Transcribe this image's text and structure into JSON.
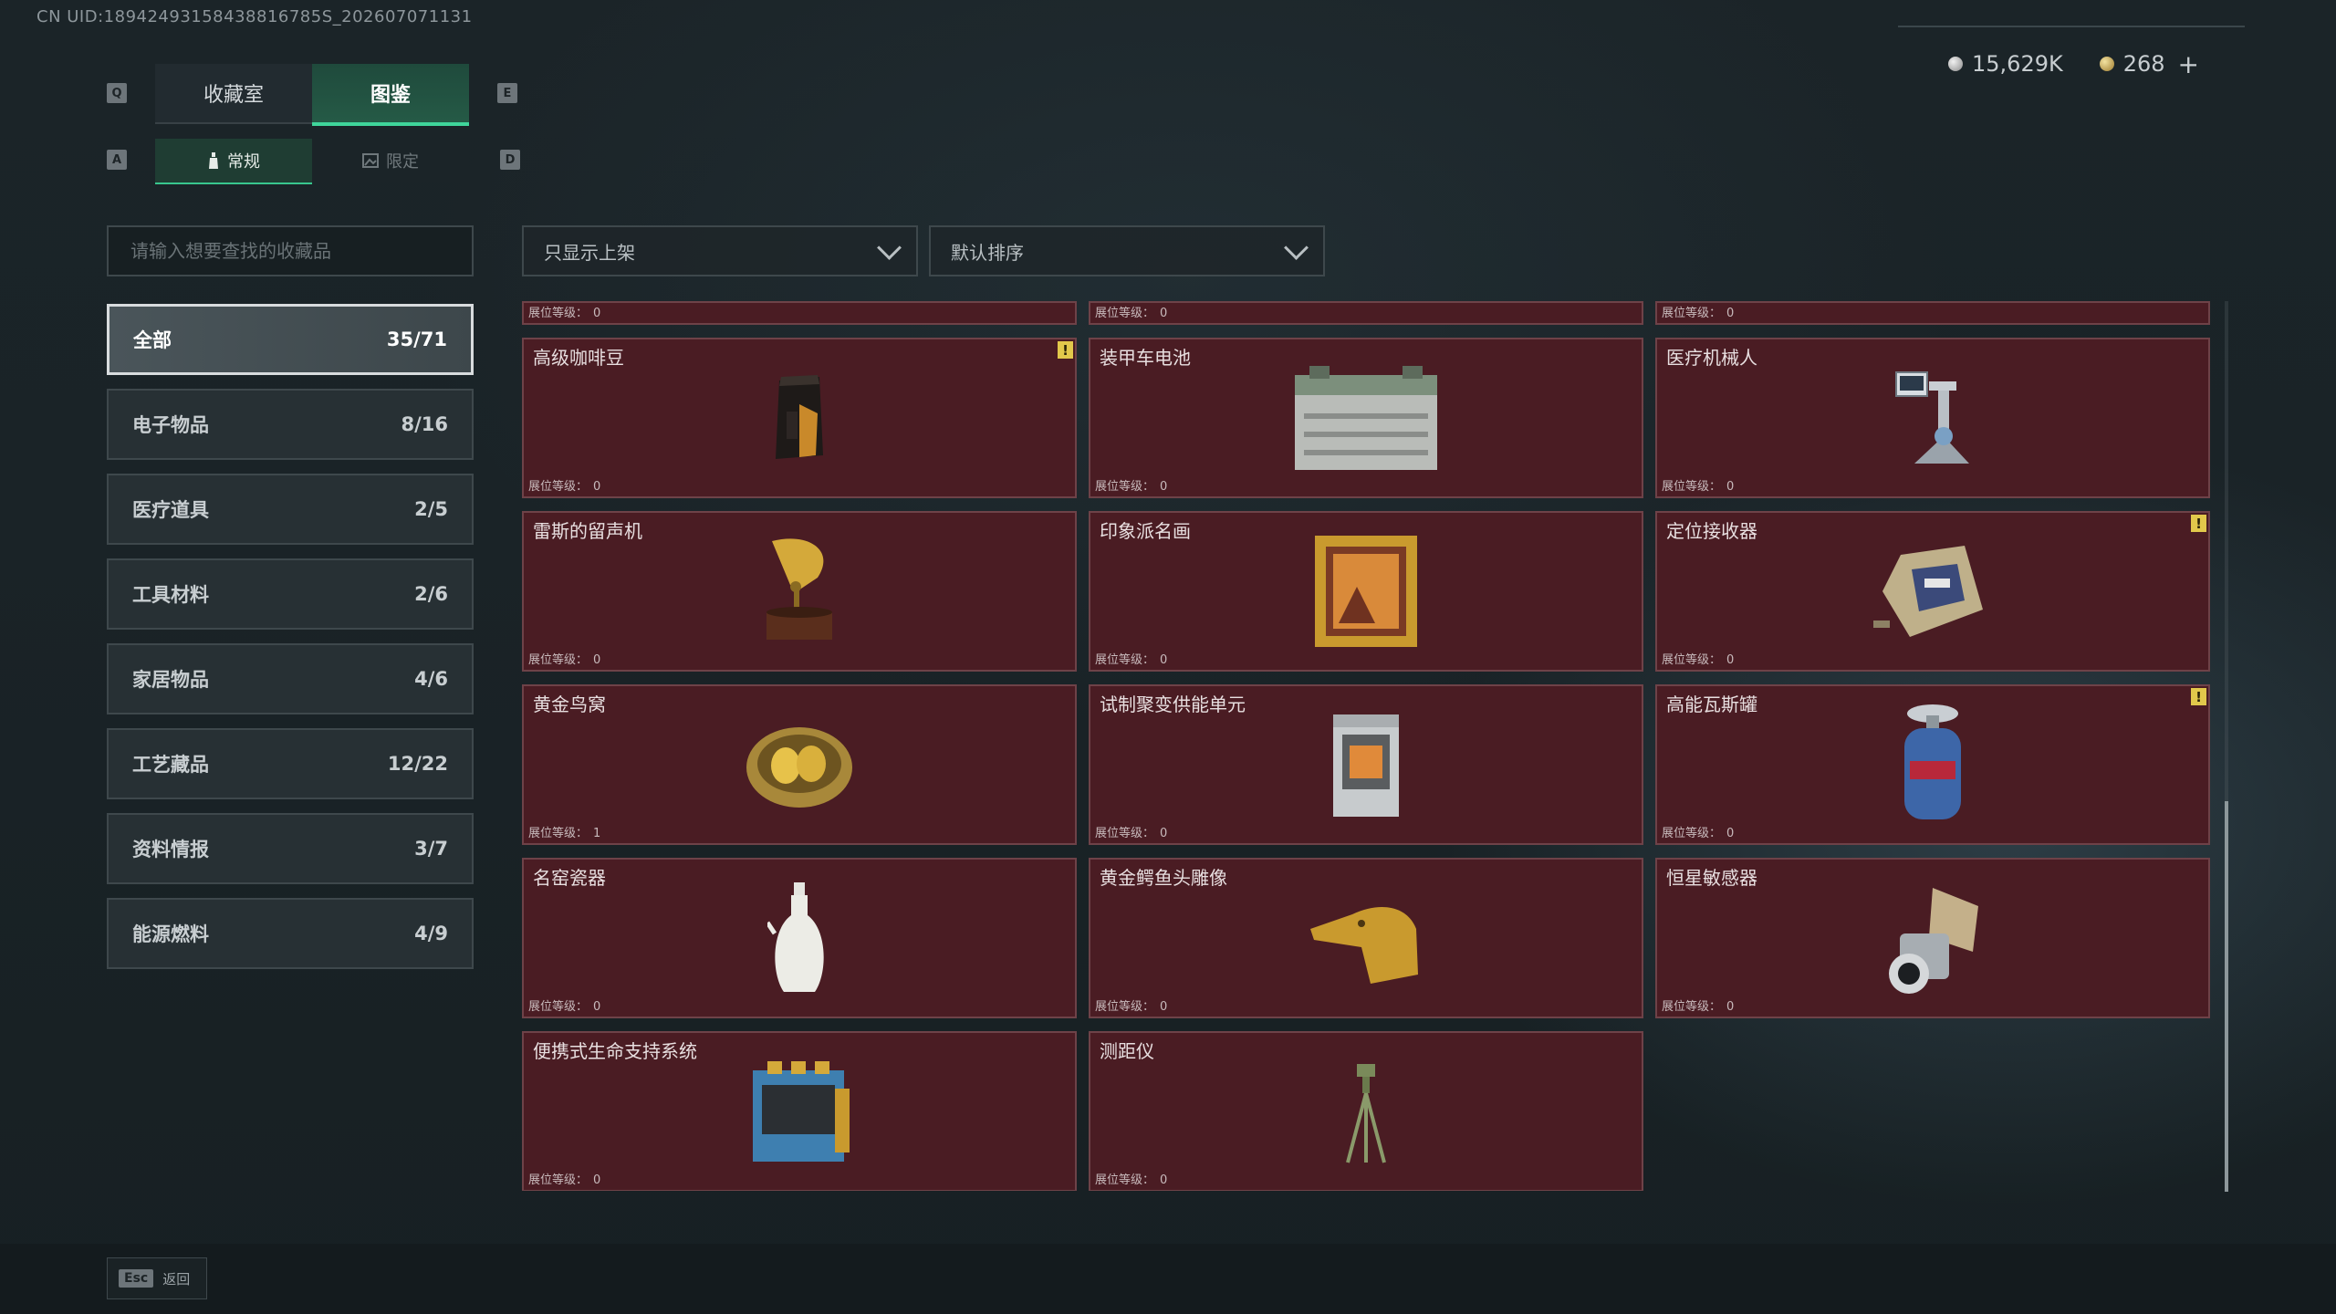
{
  "uid_text": "CN UID:18942493158438816785S_202607071131",
  "currency": {
    "silver": "15,629K",
    "gold": "268",
    "plus": "+"
  },
  "keys": {
    "prev_tab": "Q",
    "next_tab": "E",
    "prev_sub": "A",
    "next_sub": "D"
  },
  "main_tabs": [
    {
      "label": "收藏室",
      "active": false
    },
    {
      "label": "图鉴",
      "active": true
    }
  ],
  "sub_tabs": [
    {
      "label": "常规",
      "active": true
    },
    {
      "label": "限定",
      "active": false
    }
  ],
  "search": {
    "placeholder": "请输入想要查找的收藏品"
  },
  "filters": {
    "shelf_filter": "只显示上架",
    "sort": "默认排序"
  },
  "categories": [
    {
      "label": "全部",
      "count": "35/71",
      "active": true
    },
    {
      "label": "电子物品",
      "count": "8/16"
    },
    {
      "label": "医疗道具",
      "count": "2/5"
    },
    {
      "label": "工具材料",
      "count": "2/6"
    },
    {
      "label": "家居物品",
      "count": "4/6"
    },
    {
      "label": "工艺藏品",
      "count": "12/22"
    },
    {
      "label": "资料情报",
      "count": "3/7"
    },
    {
      "label": "能源燃料",
      "count": "4/9"
    }
  ],
  "level_label": "展位等级：",
  "partial_row": [
    {
      "level": "0"
    },
    {
      "level": "0"
    },
    {
      "level": "0"
    }
  ],
  "items": [
    {
      "name": "高级咖啡豆",
      "level": "0",
      "warning": true,
      "warning_icon": "!",
      "icon": "coffee-bag-icon"
    },
    {
      "name": "装甲车电池",
      "level": "0",
      "warning": false,
      "icon": "battery-icon"
    },
    {
      "name": "医疗机械人",
      "level": "0",
      "warning": false,
      "icon": "medical-robot-icon"
    },
    {
      "name": "雷斯的留声机",
      "level": "0",
      "warning": false,
      "icon": "gramophone-icon"
    },
    {
      "name": "印象派名画",
      "level": "0",
      "warning": false,
      "icon": "painting-icon"
    },
    {
      "name": "定位接收器",
      "level": "0",
      "warning": true,
      "warning_icon": "!",
      "icon": "receiver-icon"
    },
    {
      "name": "黄金鸟窝",
      "level": "1",
      "warning": false,
      "icon": "golden-nest-icon"
    },
    {
      "name": "试制聚变供能单元",
      "level": "0",
      "warning": false,
      "icon": "fusion-unit-icon"
    },
    {
      "name": "高能瓦斯罐",
      "level": "0",
      "warning": true,
      "warning_icon": "!",
      "icon": "gas-canister-icon"
    },
    {
      "name": "名窑瓷器",
      "level": "0",
      "warning": false,
      "icon": "porcelain-vase-icon"
    },
    {
      "name": "黄金鳄鱼头雕像",
      "level": "0",
      "warning": false,
      "icon": "crocodile-head-icon"
    },
    {
      "name": "恒星敏感器",
      "level": "0",
      "warning": false,
      "icon": "star-sensor-icon"
    },
    {
      "name": "便携式生命支持系统",
      "level": "0",
      "warning": false,
      "icon": "life-support-icon"
    },
    {
      "name": "测距仪",
      "level": "0",
      "warning": false,
      "icon": "rangefinder-icon"
    }
  ],
  "footer": {
    "esc_key": "Esc",
    "back_label": "返回"
  },
  "colors": {
    "card_bg": "#4a1c23",
    "accent_green": "#3fd59a",
    "warning_yellow": "#e2c84b"
  }
}
